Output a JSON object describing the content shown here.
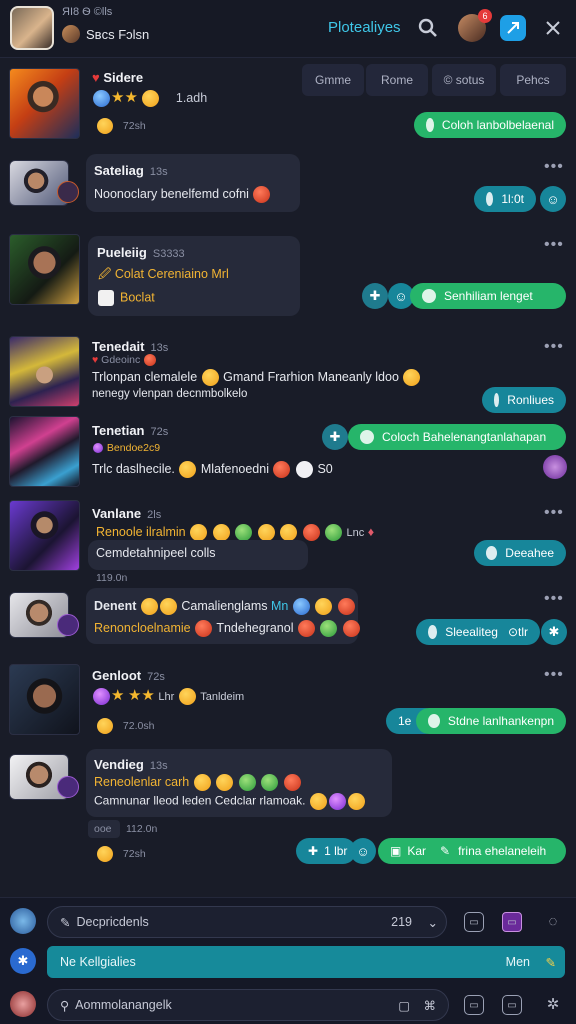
{
  "header": {
    "subtitle": "ЯI8 Ѳ ©lls",
    "name": "Sʙcs Fɔlsn",
    "link": "Plotealiyes",
    "notif_badge": "6"
  },
  "filters": [
    "Gmme",
    "Rome",
    "© sotus",
    "Pehcs"
  ],
  "rows": [
    {
      "name": "Sidere",
      "line1": "1.adh",
      "time": "72sh",
      "reply": "Coloh lanbolbelaenal"
    },
    {
      "name": "Sateliag",
      "meta": "13s",
      "line1": "Noonoclary benelfemd cofni",
      "reply_a": "1l:0t"
    },
    {
      "name": "Pueleiig",
      "meta": "S3333",
      "line1": "Colat Cereniaino Mrl",
      "line2": "Boclat",
      "reply": "Senhiliam lenget"
    },
    {
      "name": "Tenedait",
      "meta": "13s",
      "sub": "Gdeoinc",
      "line1": "Trlonpan clemalele",
      "line1b": "Gmand Frarhion Maneanly ldoo",
      "line2": "nenegy vlenpan decnmbolkelo",
      "reply": "Ronliues"
    },
    {
      "name": "Tenetian",
      "meta": "72s",
      "sub": "Bendoe2c9",
      "line1": "Trlc daslhecile.",
      "line1b": "Mlafenoedni",
      "line1c": "S0",
      "reply": "Coloch Bahelenangtanlahapan"
    },
    {
      "name": "Vanlane",
      "meta": "2ls",
      "line1": "Renoole ilralmin",
      "line1b": "Lnc",
      "line2": "Cemdetahnipeel colls",
      "time": "119.0n",
      "reply": "Deeahee"
    },
    {
      "name": "Denent",
      "line1": "Camalienglams",
      "line1b": "Mn",
      "line2": "Renoncloelnamie",
      "line2b": "Tndehegranol",
      "reply": "Sleealiteg",
      "reply_b": "tlr"
    },
    {
      "name": "Genloot",
      "meta": "72s",
      "line1": "Lhr",
      "line1b": "Tanldeim",
      "time": "72.0sh",
      "reply_a": "1e",
      "reply": "Stdne lanlhankenpn"
    },
    {
      "name": "Vendieg",
      "meta": "13s",
      "line1": "Reneolenlar carh",
      "line2": "Camnunar lleod leden Cedclar rlamoak.",
      "sub": "ooe",
      "time2": "112.0n",
      "time": "72sh",
      "reply_a": "1 lbr",
      "reply_b": "Kar",
      "reply": "frina ehelaneleih"
    }
  ],
  "composer": {
    "input1": "Decpricdenls",
    "input1_count": "219",
    "input2": "Ne Kellgialies",
    "input2_right": "Men",
    "input3": "Aommolanangelk"
  },
  "colors": {
    "accent": "#3fc7e8",
    "green": "#26b56a",
    "teal": "#17869a",
    "bg": "#191c28"
  }
}
